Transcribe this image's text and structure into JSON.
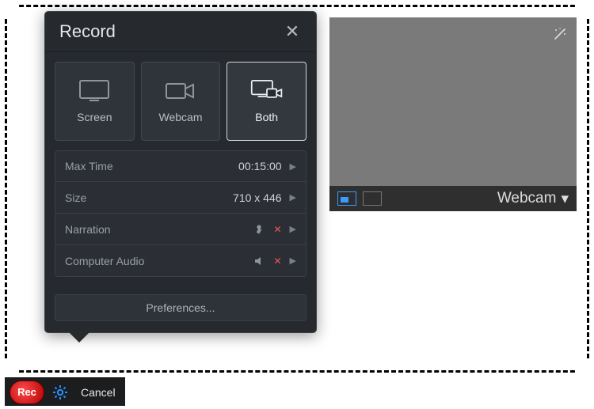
{
  "panel": {
    "title": "Record",
    "modes": {
      "screen": "Screen",
      "webcam": "Webcam",
      "both": "Both"
    },
    "settings": {
      "maxtime": {
        "label": "Max Time",
        "value": "00:15:00"
      },
      "size": {
        "label": "Size",
        "value": "710 x 446"
      },
      "narration": {
        "label": "Narration"
      },
      "audio": {
        "label": "Computer Audio"
      }
    },
    "preferences": "Preferences..."
  },
  "webcam": {
    "label": "Webcam"
  },
  "bottom": {
    "rec": "Rec",
    "cancel": "Cancel"
  }
}
